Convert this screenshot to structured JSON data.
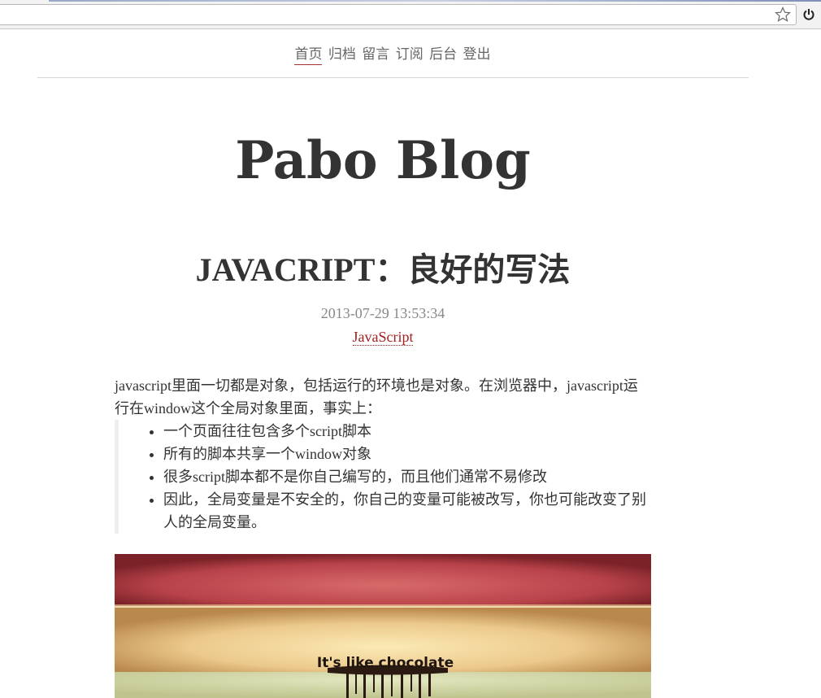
{
  "nav": {
    "items": [
      "首页",
      "归档",
      "留言",
      "订阅",
      "后台",
      "登出"
    ]
  },
  "site": {
    "title": "Pabo Blog"
  },
  "post": {
    "title_latin": "JAVACRIPT",
    "title_cjk": "：良好的写法",
    "date": "2013-07-29 13:53:34",
    "tag": "JavaScript",
    "intro": "javascript里面一切都是对象，包括运行的环境也是对象。在浏览器中，javascript运行在window这个全局对象里面，事实上：",
    "bullets": [
      "一个页面往往包含多个script脚本",
      "所有的脚本共享一个window对象",
      "很多script脚本都不是你自己编写的，而且他们通常不易修改",
      "因此，全局变量是不安全的，你自己的变量可能被改写，你也可能改变了别人的全局变量。"
    ],
    "image_caption": "It's like chocolate"
  },
  "colors": {
    "accent": "#a32020",
    "text": "#333333",
    "muted": "#888888"
  },
  "icons": {
    "bookmark": "star-icon",
    "power": "power-icon"
  }
}
